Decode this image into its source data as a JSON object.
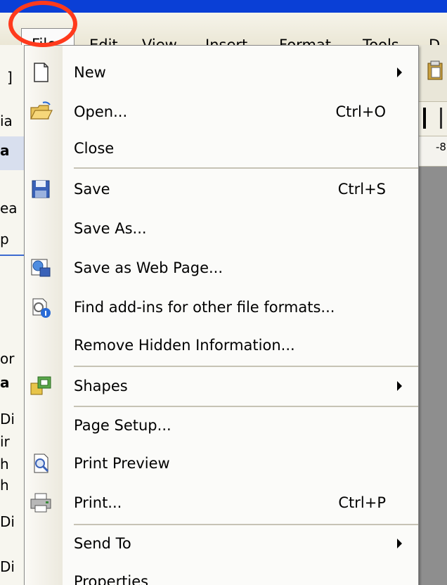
{
  "menubar": {
    "items": [
      {
        "label": "File",
        "active": true
      },
      {
        "label": "Edit"
      },
      {
        "label": "View"
      },
      {
        "label": "Insert"
      },
      {
        "label": "Format"
      },
      {
        "label": "Tools"
      },
      {
        "label": "D"
      }
    ]
  },
  "highlight": {
    "color": "#ff3a1c"
  },
  "file_menu": {
    "items": [
      {
        "label": "New",
        "icon": "new-document-icon",
        "submenu": true
      },
      {
        "label": "Open...",
        "icon": "open-folder-icon",
        "shortcut": "Ctrl+O"
      },
      {
        "label": "Close"
      },
      {
        "label": "Save",
        "icon": "save-disk-icon",
        "shortcut": "Ctrl+S"
      },
      {
        "label": "Save As..."
      },
      {
        "label": "Save as Web Page...",
        "icon": "web-page-icon"
      },
      {
        "label": "Find add-ins for other file formats...",
        "icon": "find-add-ins-icon"
      },
      {
        "label": "Remove Hidden Information..."
      },
      {
        "label": "Shapes",
        "icon": "shapes-icon",
        "submenu": true
      },
      {
        "label": "Page Setup..."
      },
      {
        "label": "Print Preview",
        "icon": "print-preview-icon"
      },
      {
        "label": "Print...",
        "icon": "printer-icon",
        "shortcut": "Ctrl+P"
      },
      {
        "label": "Send To",
        "submenu": true
      },
      {
        "label": "Properties"
      }
    ]
  },
  "background": {
    "left_fragments": [
      "]",
      "ia",
      "a",
      "ea",
      "p",
      "or",
      "a",
      "Di",
      "ir",
      "h",
      "h",
      "Di",
      "Di"
    ],
    "ruler_text": "-8"
  },
  "colors": {
    "accent": "#0a3fd6",
    "menu_bg": "#fbfbf9",
    "separator": "#c6c3b5"
  }
}
